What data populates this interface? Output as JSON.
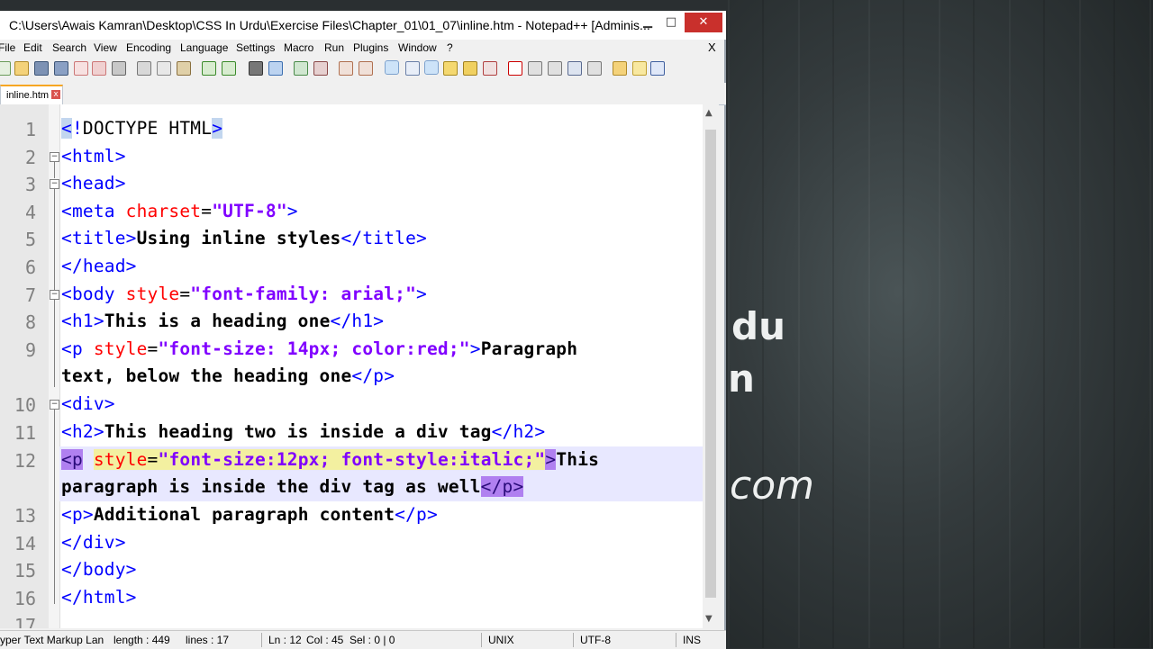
{
  "window": {
    "title": "C:\\Users\\Awais Kamran\\Desktop\\CSS In Urdu\\Exercise Files\\Chapter_01\\01_07\\inline.htm - Notepad++ [Adminis...",
    "min": "▁",
    "max": "□",
    "close": "✕"
  },
  "menu": [
    "File",
    "Edit",
    "Search",
    "View",
    "Encoding",
    "Language",
    "Settings",
    "Macro",
    "Run",
    "Plugins",
    "Window",
    "?"
  ],
  "menu_close": "X",
  "tab": {
    "label": "inline.htm",
    "close": "x"
  },
  "editor": {
    "line_numbers": [
      "1",
      "2",
      "3",
      "4",
      "5",
      "6",
      "7",
      "8",
      "9",
      "10",
      "11",
      "12",
      "13",
      "14",
      "15",
      "16",
      "17"
    ]
  },
  "status": {
    "type": "yper Text Markup Lan",
    "length": "length : 449",
    "lines": "lines : 17",
    "ln": "Ln : 12",
    "col": "Col : 45",
    "sel": "Sel : 0 | 0",
    "eol": "UNIX",
    "encoding": "UTF-8",
    "mode": "INS"
  },
  "background_text": [
    "du",
    "n",
    "com"
  ],
  "colors": {
    "tag": "#0000ff",
    "attribute": "#ff0000",
    "attr_value": "#8000ff",
    "close_button": "#c9302c"
  }
}
